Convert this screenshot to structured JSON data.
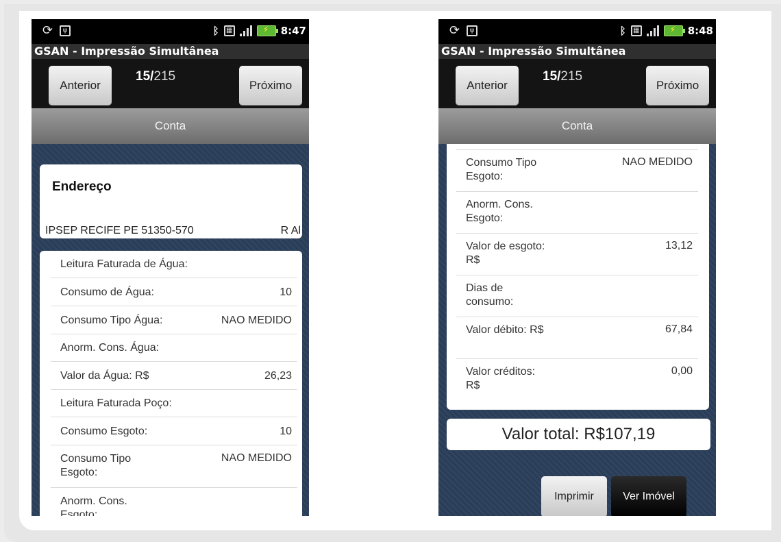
{
  "left": {
    "status": {
      "time": "8:47"
    },
    "app_title": "GSAN - Impressão Simultânea",
    "nav": {
      "prev_label": "Anterior",
      "next_label": "Próximo",
      "current": "15/",
      "total": "215"
    },
    "section_label": "Conta",
    "address": {
      "heading": "Endereço",
      "line": "IPSEP RECIFE PE 51350-570",
      "trail": "R Al"
    },
    "rows": [
      {
        "label": "Leitura Faturada de Água:",
        "value": ""
      },
      {
        "label": "Consumo de Água:",
        "value": "10"
      },
      {
        "label": "Consumo Tipo Água:",
        "value": "NAO MEDIDO"
      },
      {
        "label": "Anorm. Cons. Água:",
        "value": ""
      },
      {
        "label": "Valor da Água: R$",
        "value": "26,23"
      },
      {
        "label": "Leitura Faturada Poço:",
        "value": ""
      },
      {
        "label": "Consumo Esgoto:",
        "value": "10"
      },
      {
        "label": "Consumo Tipo Esgoto:",
        "value": "NAO MEDIDO"
      },
      {
        "label": "Anorm. Cons. Esgoto:",
        "value": ""
      }
    ]
  },
  "right": {
    "status": {
      "time": "8:48"
    },
    "app_title": "GSAN - Impressão Simultânea",
    "nav": {
      "prev_label": "Anterior",
      "next_label": "Próximo",
      "current": "15/",
      "total": "215"
    },
    "section_label": "Conta",
    "rows": [
      {
        "label": "Consumo Tipo Esgoto:",
        "value": "NAO MEDIDO"
      },
      {
        "label": "Anorm. Cons. Esgoto:",
        "value": ""
      },
      {
        "label": "Valor de esgoto: R$",
        "value": "13,12"
      },
      {
        "label": "Dias de consumo:",
        "value": ""
      },
      {
        "label": "Valor débito: R$",
        "value": "67,84"
      },
      {
        "label": "Valor créditos: R$",
        "value": "0,00"
      }
    ],
    "total": "Valor total: R$107,19",
    "print_label": "Imprimir",
    "view_property_label": "Ver Imóvel"
  },
  "colors": {
    "background": "#2b3e59",
    "statusbar": "#000000",
    "battery": "#5fb832"
  },
  "icons": [
    "sync-icon",
    "usb-icon",
    "bluetooth-icon",
    "sd-card-icon",
    "signal-icon",
    "battery-charging-icon"
  ]
}
